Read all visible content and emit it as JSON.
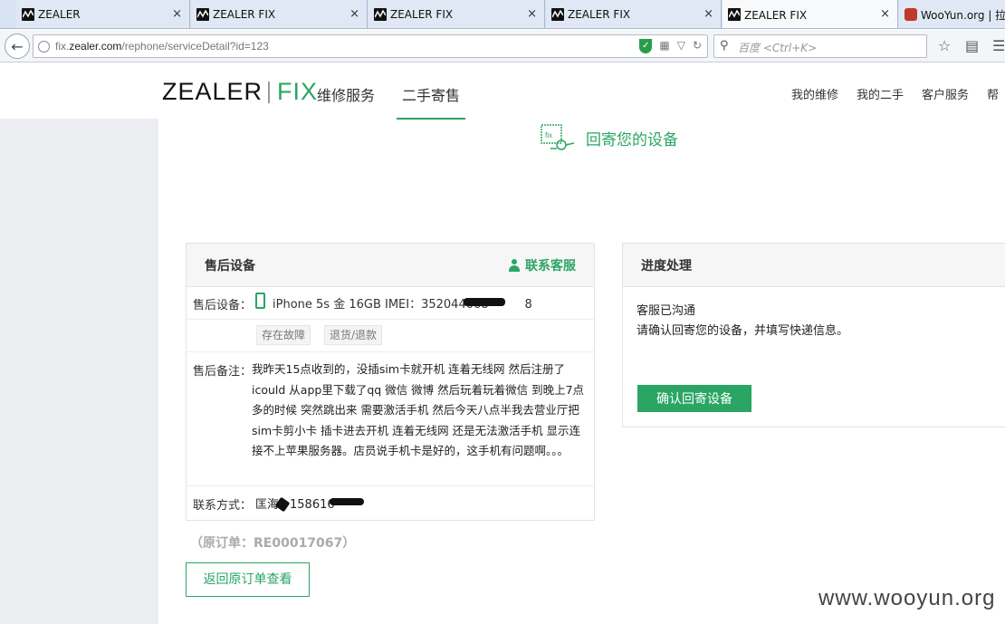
{
  "browser": {
    "tabs": [
      {
        "label": "ZEALER"
      },
      {
        "label": "ZEALER FIX"
      },
      {
        "label": "ZEALER FIX"
      },
      {
        "label": "ZEALER FIX"
      },
      {
        "label": "ZEALER FIX",
        "active": true
      },
      {
        "label": "WooYun.org | 拉"
      }
    ],
    "url_prefix": "fix.",
    "url_domain": "zealer.com",
    "url_path": "/rephone/serviceDetail?id=123",
    "search_placeholder": "百度 <Ctrl+K>",
    "close_glyph": "×"
  },
  "header": {
    "logo_main": "ZEALER",
    "logo_sub": "FIX",
    "nav": [
      "维修服务",
      "二手寄售"
    ],
    "right_nav": [
      "我的维修",
      "我的二手",
      "客户服务",
      "帮"
    ]
  },
  "step": {
    "title": "回寄您的设备"
  },
  "after_sales": {
    "title": "售后设备",
    "contact_label": "联系客服",
    "device_label": "售后设备：",
    "device_value": "iPhone 5s 金 16GB IMEI：352044068",
    "device_value_tail": "8",
    "tags": [
      "存在故障",
      "退货/退款"
    ],
    "note_label": "售后备注：",
    "note_text": "我昨天15点收到的，没插sim卡就开机 连着无线网 然后注册了icould 从app里下载了qq 微信 微博 然后玩着玩着微信 到晚上7点多的时候 突然跳出来 需要激活手机 然后今天八点半我去营业厅把sim卡剪小卡 插卡进去开机 连着无线网 还是无法激活手机 显示连接不上苹果服务器。店员说手机卡是好的，这手机有问题啊。。。",
    "contact_info_label": "联系方式：",
    "contact_name": "匡海",
    "contact_phone": "158616",
    "order_no": "（原订单：RE00017067）",
    "back_button": "返回原订单查看"
  },
  "progress": {
    "title": "进度处理",
    "line1": "客服已沟通",
    "line2": "请确认回寄您的设备，并填写快递信息。",
    "confirm_button": "确认回寄设备"
  },
  "watermark": "www.wooyun.org",
  "colors": {
    "brand_green": "#2aa564",
    "sidebar_gray": "#eceef1"
  }
}
